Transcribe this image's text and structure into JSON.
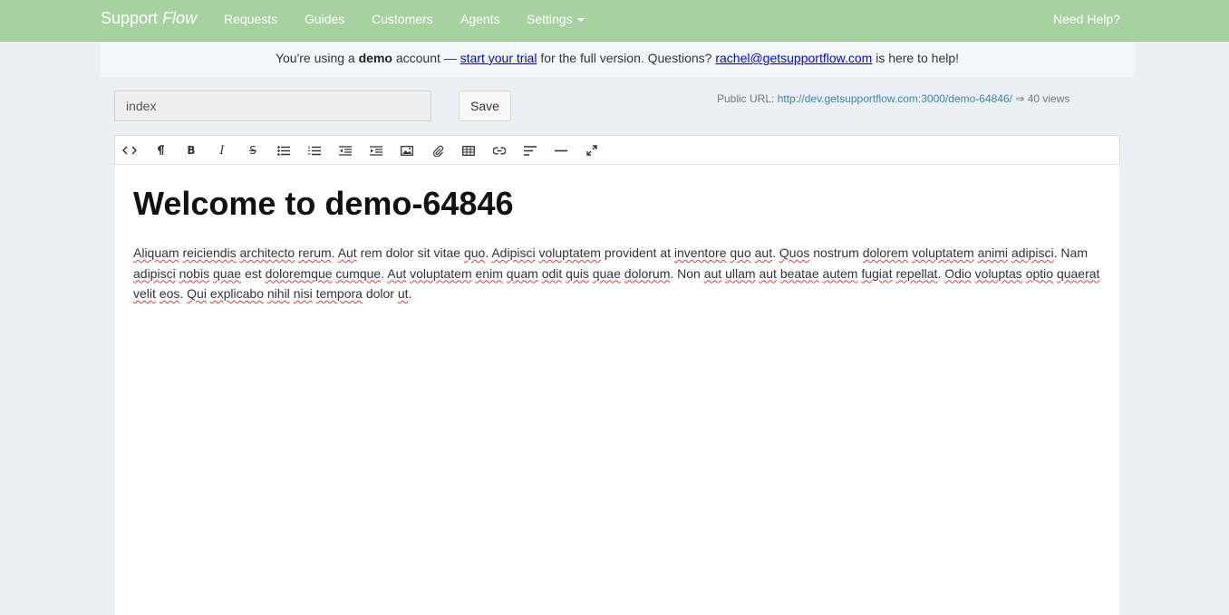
{
  "navbar": {
    "brand_prefix": "Support",
    "brand_suffix": "Flow",
    "links": [
      "Requests",
      "Guides",
      "Customers",
      "Agents"
    ],
    "settings_label": "Settings",
    "help_label": "Need Help?"
  },
  "banner": {
    "part1": "You're using a ",
    "bold": "demo",
    "part2": " account — ",
    "trial_link": "start your trial",
    "part3": " for the full version. Questions? ",
    "email_link": "rachel@getsupportflow.com",
    "part4": " is here to help!"
  },
  "form": {
    "title_value": "index",
    "save_label": "Save"
  },
  "public_url": {
    "label": "Public URL: ",
    "url": "http://dev.getsupportflow.com:3000/demo-64846/",
    "views": " ⇒ 40 views"
  },
  "toolbar": {
    "icons": [
      "html-code-icon",
      "paragraph-format-icon",
      "bold-icon",
      "italic-icon",
      "strikethrough-icon",
      "unordered-list-icon",
      "ordered-list-icon",
      "outdent-icon",
      "indent-icon",
      "image-icon",
      "file-attach-icon",
      "table-icon",
      "link-icon",
      "align-left-icon",
      "horizontal-rule-icon",
      "fullscreen-icon"
    ]
  },
  "editor": {
    "heading": "Welcome to demo-64846",
    "body": [
      {
        "t": "Aliquam",
        "s": true
      },
      {
        "t": " "
      },
      {
        "t": "reiciendis",
        "s": true
      },
      {
        "t": " "
      },
      {
        "t": "architecto",
        "s": true
      },
      {
        "t": " "
      },
      {
        "t": "rerum",
        "s": true
      },
      {
        "t": ". "
      },
      {
        "t": "Aut",
        "s": true
      },
      {
        "t": " rem dolor sit vitae "
      },
      {
        "t": "quo",
        "s": true
      },
      {
        "t": ". "
      },
      {
        "t": "Adipisci",
        "s": true
      },
      {
        "t": " "
      },
      {
        "t": "voluptatem",
        "s": true
      },
      {
        "t": " provident at "
      },
      {
        "t": "inventore",
        "s": true
      },
      {
        "t": " "
      },
      {
        "t": "quo",
        "s": true
      },
      {
        "t": " "
      },
      {
        "t": "aut",
        "s": true
      },
      {
        "t": ". "
      },
      {
        "t": "Quos",
        "s": true
      },
      {
        "t": " nostrum "
      },
      {
        "t": "dolorem",
        "s": true
      },
      {
        "t": " "
      },
      {
        "t": "voluptatem",
        "s": true
      },
      {
        "t": " "
      },
      {
        "t": "animi",
        "s": true
      },
      {
        "t": " "
      },
      {
        "t": "adipisci",
        "s": true
      },
      {
        "t": ". Nam "
      },
      {
        "t": "adipisci",
        "s": true
      },
      {
        "t": " "
      },
      {
        "t": "nobis",
        "s": true
      },
      {
        "t": " "
      },
      {
        "t": "quae",
        "s": true
      },
      {
        "t": " est "
      },
      {
        "t": "doloremque",
        "s": true
      },
      {
        "t": " "
      },
      {
        "t": "cumque",
        "s": true
      },
      {
        "t": ". "
      },
      {
        "t": "Aut",
        "s": true
      },
      {
        "t": " "
      },
      {
        "t": "voluptatem",
        "s": true
      },
      {
        "t": " "
      },
      {
        "t": "enim",
        "s": true
      },
      {
        "t": " "
      },
      {
        "t": "quam",
        "s": true
      },
      {
        "t": " "
      },
      {
        "t": "odit",
        "s": true
      },
      {
        "t": " "
      },
      {
        "t": "quis",
        "s": true
      },
      {
        "t": " "
      },
      {
        "t": "quae",
        "s": true
      },
      {
        "t": " "
      },
      {
        "t": "dolorum",
        "s": true
      },
      {
        "t": ". Non "
      },
      {
        "t": "aut",
        "s": true
      },
      {
        "t": " "
      },
      {
        "t": "ullam",
        "s": true
      },
      {
        "t": " "
      },
      {
        "t": "aut",
        "s": true
      },
      {
        "t": " "
      },
      {
        "t": "beatae",
        "s": true
      },
      {
        "t": " "
      },
      {
        "t": "autem",
        "s": true
      },
      {
        "t": " "
      },
      {
        "t": "fugiat",
        "s": true
      },
      {
        "t": " "
      },
      {
        "t": "repellat",
        "s": true
      },
      {
        "t": ". "
      },
      {
        "t": "Odio",
        "s": true
      },
      {
        "t": " "
      },
      {
        "t": "voluptas",
        "s": true
      },
      {
        "t": " "
      },
      {
        "t": "optio",
        "s": true
      },
      {
        "t": " "
      },
      {
        "t": "quaerat",
        "s": true
      },
      {
        "t": " "
      },
      {
        "t": "velit",
        "s": true
      },
      {
        "t": " "
      },
      {
        "t": "eos",
        "s": true
      },
      {
        "t": ". "
      },
      {
        "t": "Qui",
        "s": true
      },
      {
        "t": " "
      },
      {
        "t": "explicabo",
        "s": true
      },
      {
        "t": " "
      },
      {
        "t": "nihil",
        "s": true
      },
      {
        "t": " "
      },
      {
        "t": "nisi",
        "s": true
      },
      {
        "t": " "
      },
      {
        "t": "tempora",
        "s": true
      },
      {
        "t": " dolor "
      },
      {
        "t": "ut",
        "s": true
      },
      {
        "t": "."
      }
    ]
  },
  "colors": {
    "navbar_bg": "#a7d1a0",
    "page_bg": "#eceff3",
    "banner_bg": "#f5f8fb",
    "link": "#0000ee",
    "url_link": "#3a87ad",
    "spellcheck": "#e0393b"
  }
}
